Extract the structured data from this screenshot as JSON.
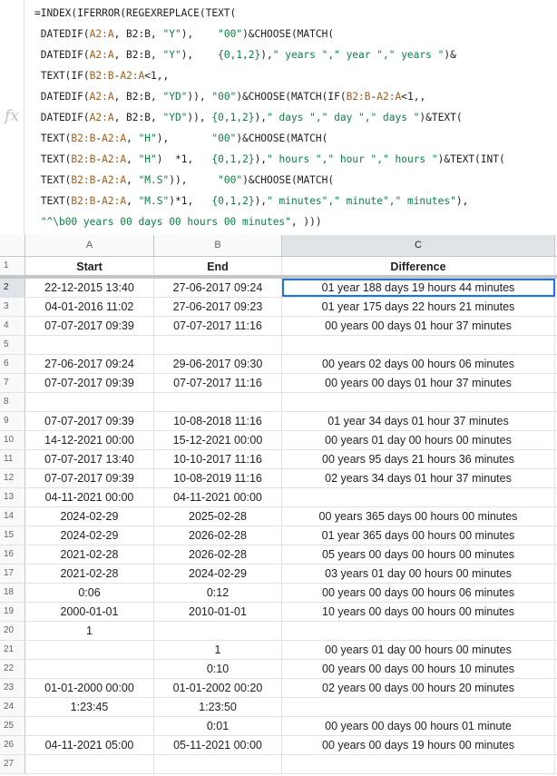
{
  "formula_bar": {
    "icon": "fx",
    "lines": [
      [
        {
          "t": "=INDEX(IFERROR(REGEXREPLACE(TEXT(",
          "c": ""
        }
      ],
      [
        {
          "t": " DATEDIF(",
          "c": ""
        },
        {
          "t": "A2:A",
          "c": "ref"
        },
        {
          "t": ", B2:B, ",
          "c": ""
        },
        {
          "t": "\"Y\"",
          "c": "str"
        },
        {
          "t": "),    ",
          "c": ""
        },
        {
          "t": "\"00\"",
          "c": "str"
        },
        {
          "t": ")&CHOOSE(MATCH(",
          "c": ""
        }
      ],
      [
        {
          "t": " DATEDIF(",
          "c": ""
        },
        {
          "t": "A2:A",
          "c": "ref"
        },
        {
          "t": ", B2:B, ",
          "c": ""
        },
        {
          "t": "\"Y\"",
          "c": "str"
        },
        {
          "t": "),    ",
          "c": ""
        },
        {
          "t": "{0,1,2}",
          "c": "num"
        },
        {
          "t": "),",
          "c": ""
        },
        {
          "t": "\" years \",\" year \",\" years \"",
          "c": "str"
        },
        {
          "t": ")&",
          "c": ""
        }
      ],
      [
        {
          "t": " TEXT(IF(",
          "c": ""
        },
        {
          "t": "B2:B",
          "c": "ref"
        },
        {
          "t": "-",
          "c": ""
        },
        {
          "t": "A2:A",
          "c": "ref"
        },
        {
          "t": "<1,,",
          "c": ""
        }
      ],
      [
        {
          "t": " DATEDIF(",
          "c": ""
        },
        {
          "t": "A2:A",
          "c": "ref"
        },
        {
          "t": ", B2:B, ",
          "c": ""
        },
        {
          "t": "\"YD\"",
          "c": "str"
        },
        {
          "t": ")), ",
          "c": ""
        },
        {
          "t": "\"00\"",
          "c": "str"
        },
        {
          "t": ")&CHOOSE(MATCH(IF(",
          "c": ""
        },
        {
          "t": "B2:B",
          "c": "ref"
        },
        {
          "t": "-",
          "c": ""
        },
        {
          "t": "A2:A",
          "c": "ref"
        },
        {
          "t": "<1,,",
          "c": ""
        }
      ],
      [
        {
          "t": " DATEDIF(",
          "c": ""
        },
        {
          "t": "A2:A",
          "c": "ref"
        },
        {
          "t": ", B2:B, ",
          "c": ""
        },
        {
          "t": "\"YD\"",
          "c": "str"
        },
        {
          "t": ")), ",
          "c": ""
        },
        {
          "t": "{0,1,2}",
          "c": "num"
        },
        {
          "t": "),",
          "c": ""
        },
        {
          "t": "\" days \",\" day \",\" days \"",
          "c": "str"
        },
        {
          "t": ")&TEXT(",
          "c": ""
        }
      ],
      [
        {
          "t": " TEXT(",
          "c": ""
        },
        {
          "t": "B2:B",
          "c": "ref"
        },
        {
          "t": "-",
          "c": ""
        },
        {
          "t": "A2:A",
          "c": "ref"
        },
        {
          "t": ", ",
          "c": ""
        },
        {
          "t": "\"H\"",
          "c": "str"
        },
        {
          "t": "),       ",
          "c": ""
        },
        {
          "t": "\"00\"",
          "c": "str"
        },
        {
          "t": ")&CHOOSE(MATCH(",
          "c": ""
        }
      ],
      [
        {
          "t": " TEXT(",
          "c": ""
        },
        {
          "t": "B2:B",
          "c": "ref"
        },
        {
          "t": "-",
          "c": ""
        },
        {
          "t": "A2:A",
          "c": "ref"
        },
        {
          "t": ", ",
          "c": ""
        },
        {
          "t": "\"H\"",
          "c": "str"
        },
        {
          "t": ")  *1,   ",
          "c": ""
        },
        {
          "t": "{0,1,2}",
          "c": "num"
        },
        {
          "t": "),",
          "c": ""
        },
        {
          "t": "\" hours \",\" hour \",\" hours \"",
          "c": "str"
        },
        {
          "t": ")&TEXT(INT(",
          "c": ""
        }
      ],
      [
        {
          "t": " TEXT(",
          "c": ""
        },
        {
          "t": "B2:B",
          "c": "ref"
        },
        {
          "t": "-",
          "c": ""
        },
        {
          "t": "A2:A",
          "c": "ref"
        },
        {
          "t": ", ",
          "c": ""
        },
        {
          "t": "\"M.S\"",
          "c": "str"
        },
        {
          "t": ")),     ",
          "c": ""
        },
        {
          "t": "\"00\"",
          "c": "str"
        },
        {
          "t": ")&CHOOSE(MATCH(",
          "c": ""
        }
      ],
      [
        {
          "t": " TEXT(",
          "c": ""
        },
        {
          "t": "B2:B",
          "c": "ref"
        },
        {
          "t": "-",
          "c": ""
        },
        {
          "t": "A2:A",
          "c": "ref"
        },
        {
          "t": ", ",
          "c": ""
        },
        {
          "t": "\"M.S\"",
          "c": "str"
        },
        {
          "t": ")*1,   ",
          "c": ""
        },
        {
          "t": "{0,1,2}",
          "c": "num"
        },
        {
          "t": "),",
          "c": ""
        },
        {
          "t": "\" minutes\",\" minute\",\" minutes\"",
          "c": "str"
        },
        {
          "t": "),",
          "c": ""
        }
      ],
      [
        {
          "t": " ",
          "c": ""
        },
        {
          "t": "\"^\\b00 years 00 days 00 hours 00 minutes\"",
          "c": "str"
        },
        {
          "t": ", ))) ",
          "c": ""
        }
      ]
    ]
  },
  "columns": [
    "A",
    "B",
    "C"
  ],
  "selected_column": "C",
  "selected_row": "2",
  "rows": [
    {
      "n": "1",
      "a": "Start",
      "b": "End",
      "c": "Difference"
    },
    {
      "n": "2",
      "a": "22-12-2015  13:40",
      "b": "27-06-2017  09:24",
      "c": "01 year 188 days 19 hours 44 minutes"
    },
    {
      "n": "3",
      "a": "04-01-2016  11:02",
      "b": "27-06-2017  09:23",
      "c": "01 year 175 days 22 hours 21 minutes"
    },
    {
      "n": "4",
      "a": "07-07-2017  09:39",
      "b": "07-07-2017  11:16",
      "c": "00 years 00 days 01 hour 37 minutes"
    },
    {
      "n": "5",
      "a": "",
      "b": "",
      "c": ""
    },
    {
      "n": "6",
      "a": "27-06-2017  09:24",
      "b": "29-06-2017  09:30",
      "c": "00 years 02 days 00 hours 06 minutes"
    },
    {
      "n": "7",
      "a": "07-07-2017  09:39",
      "b": "07-07-2017  11:16",
      "c": "00 years 00 days 01 hour 37 minutes"
    },
    {
      "n": "8",
      "a": "",
      "b": "",
      "c": ""
    },
    {
      "n": "9",
      "a": "07-07-2017  09:39",
      "b": "10-08-2018  11:16",
      "c": "01 year 34 days 01 hour 37 minutes"
    },
    {
      "n": "10",
      "a": "14-12-2021  00:00",
      "b": "15-12-2021  00:00",
      "c": "00 years 01 day 00 hours 00 minutes"
    },
    {
      "n": "11",
      "a": "07-07-2017  13:40",
      "b": "10-10-2017  11:16",
      "c": "00 years 95 days 21 hours 36 minutes"
    },
    {
      "n": "12",
      "a": "07-07-2017  09:39",
      "b": "10-08-2019  11:16",
      "c": "02 years 34 days 01 hour 37 minutes"
    },
    {
      "n": "13",
      "a": "04-11-2021  00:00",
      "b": "04-11-2021  00:00",
      "c": ""
    },
    {
      "n": "14",
      "a": "2024-02-29",
      "b": "2025-02-28",
      "c": "00 years 365 days 00 hours 00 minutes"
    },
    {
      "n": "15",
      "a": "2024-02-29",
      "b": "2026-02-28",
      "c": "01 year 365 days 00 hours 00 minutes"
    },
    {
      "n": "16",
      "a": "2021-02-28",
      "b": "2026-02-28",
      "c": "05 years 00 days 00 hours 00 minutes"
    },
    {
      "n": "17",
      "a": "2021-02-28",
      "b": "2024-02-29",
      "c": "03 years 01 day 00 hours 00 minutes"
    },
    {
      "n": "18",
      "a": "0:06",
      "b": "0:12",
      "c": "00 years 00 days 00 hours 06 minutes"
    },
    {
      "n": "19",
      "a": "2000-01-01",
      "b": "2010-01-01",
      "c": "10 years 00 days 00 hours 00 minutes"
    },
    {
      "n": "20",
      "a": "1",
      "b": "",
      "c": ""
    },
    {
      "n": "21",
      "a": "",
      "b": "1",
      "c": "00 years 01 day 00 hours 00 minutes"
    },
    {
      "n": "22",
      "a": "",
      "b": "0:10",
      "c": "00 years 00 days 00 hours 10 minutes"
    },
    {
      "n": "23",
      "a": "01-01-2000  00:00",
      "b": "01-01-2002  00:20",
      "c": "02 years 00 days 00 hours 20 minutes"
    },
    {
      "n": "24",
      "a": "1:23:45",
      "b": "1:23:50",
      "c": ""
    },
    {
      "n": "25",
      "a": "",
      "b": "0:01",
      "c": "00 years 00 days 00 hours 01 minute"
    },
    {
      "n": "26",
      "a": "04-11-2021  05:00",
      "b": "05-11-2021  00:00",
      "c": "00 years 00 days 19 hours 00 minutes"
    },
    {
      "n": "27",
      "a": "",
      "b": "",
      "c": ""
    }
  ]
}
